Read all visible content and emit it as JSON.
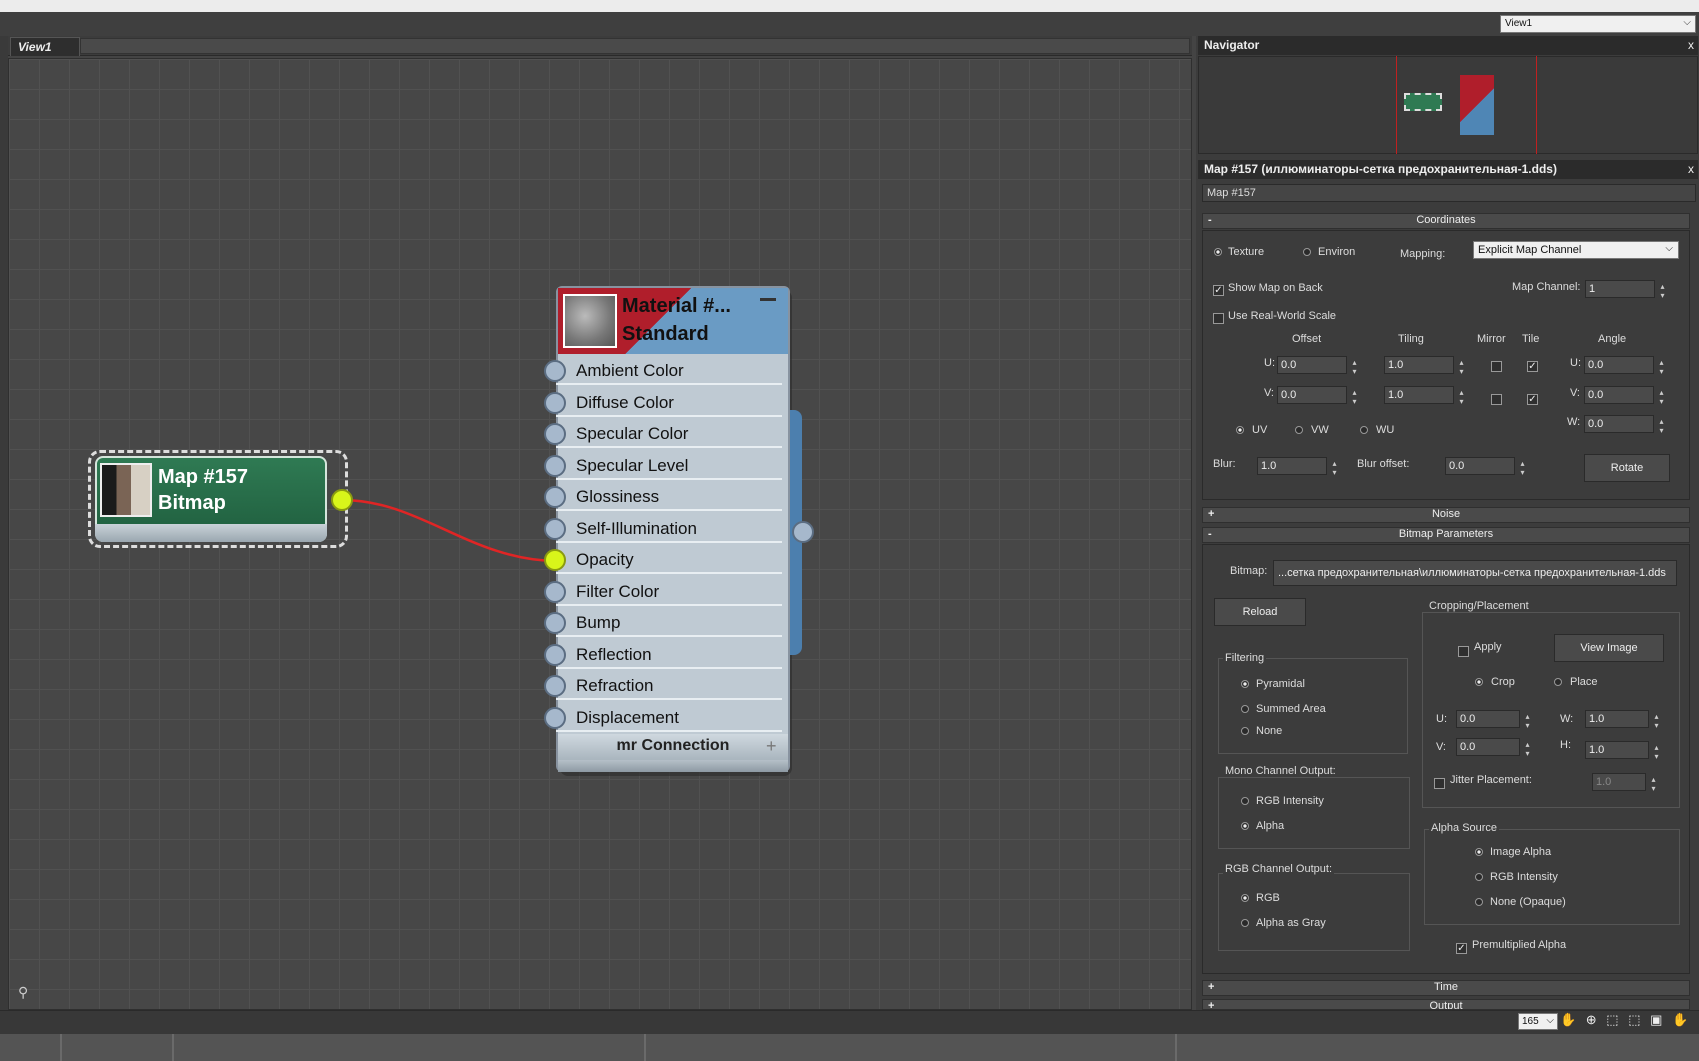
{
  "top": {
    "view_select": "View1"
  },
  "view": {
    "tab_label": "View1"
  },
  "map_node": {
    "name": "Map #157",
    "type": "Bitmap"
  },
  "material_node": {
    "name": "Material #...",
    "type": "Standard",
    "slots": [
      "Ambient Color",
      "Diffuse Color",
      "Specular Color",
      "Specular Level",
      "Glossiness",
      "Self-Illumination",
      "Opacity",
      "Filter Color",
      "Bump",
      "Reflection",
      "Refraction",
      "Displacement"
    ],
    "connected_slot": "Opacity",
    "footer": "mr Connection",
    "footer_plus": "+",
    "minimize": "—"
  },
  "navigator": {
    "title": "Navigator",
    "close": "x"
  },
  "params_panel": {
    "title": "Map #157 (иллюминаторы-сетка предохранительная-1.dds)",
    "close": "x",
    "map_name_field": "Map #157",
    "coordinates": {
      "header": "Coordinates",
      "toggle": "-",
      "texture": "Texture",
      "environ": "Environ",
      "mapping_label": "Mapping:",
      "mapping_value": "Explicit Map Channel",
      "show_map_on_back": "Show Map on Back",
      "map_channel_label": "Map Channel:",
      "map_channel_value": "1",
      "use_real_world": "Use Real-World Scale",
      "col_offset": "Offset",
      "col_tiling": "Tiling",
      "col_mirror": "Mirror",
      "col_tile": "Tile",
      "col_angle": "Angle",
      "u": "U:",
      "v": "V:",
      "w": "W:",
      "u_offset": "0.0",
      "v_offset": "0.0",
      "u_tiling": "1.0",
      "v_tiling": "1.0",
      "u_angle": "0.0",
      "v_angle": "0.0",
      "w_angle": "0.0",
      "uv": "UV",
      "vw": "VW",
      "wu": "WU",
      "blur_label": "Blur:",
      "blur_value": "1.0",
      "blur_offset_label": "Blur offset:",
      "blur_offset_value": "0.0",
      "rotate": "Rotate"
    },
    "noise": {
      "header": "Noise",
      "toggle": "+"
    },
    "bitmap_params": {
      "header": "Bitmap Parameters",
      "toggle": "-",
      "bitmap_label": "Bitmap:",
      "bitmap_path": "...сетка предохранительная\\иллюминаторы-сетка предохранительная-1.dds",
      "reload": "Reload",
      "filtering": {
        "title": "Filtering",
        "pyramidal": "Pyramidal",
        "summed_area": "Summed Area",
        "none": "None"
      },
      "mono": {
        "title": "Mono Channel Output:",
        "rgb_intensity": "RGB Intensity",
        "alpha": "Alpha"
      },
      "rgb": {
        "title": "RGB Channel Output:",
        "rgb": "RGB",
        "alpha_gray": "Alpha as Gray"
      },
      "cropping": {
        "title": "Cropping/Placement",
        "apply": "Apply",
        "view_image": "View Image",
        "crop": "Crop",
        "place": "Place",
        "u": "U:",
        "u_value": "0.0",
        "w": "W:",
        "w_value": "1.0",
        "v": "V:",
        "v_value": "0.0",
        "h": "H:",
        "h_value": "1.0",
        "jitter": "Jitter Placement:",
        "jitter_value": "1.0"
      },
      "alpha_source": {
        "title": "Alpha Source",
        "image_alpha": "Image Alpha",
        "rgb_intensity": "RGB Intensity",
        "none_opaque": "None (Opaque)"
      },
      "premultiplied": "Premultiplied Alpha"
    },
    "time": {
      "header": "Time",
      "toggle": "+"
    },
    "output": {
      "header": "Output",
      "toggle": "+"
    }
  },
  "statusbar": {
    "zoom": "165",
    "icons": "✋ ⊕ ⬚ ⬚ ▣ ✋"
  }
}
